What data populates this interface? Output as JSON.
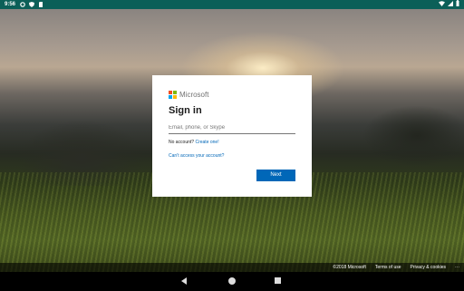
{
  "status_bar": {
    "time": "9:56",
    "icons": [
      "settings-icon",
      "shield-icon",
      "sd-card-icon"
    ],
    "right_icons": [
      "wifi-icon",
      "signal-icon",
      "battery-icon"
    ]
  },
  "signin": {
    "brand": "Microsoft",
    "title": "Sign in",
    "email_placeholder": "Email, phone, or Skype",
    "no_account_text": "No account?",
    "create_link": "Create one!",
    "cant_access": "Can’t access your account?",
    "next_label": "Next"
  },
  "footer": {
    "copyright": "©2018 Microsoft",
    "terms": "Terms of use",
    "privacy": "Privacy & cookies",
    "more": "···"
  },
  "colors": {
    "status_bar": "#0b5f58",
    "accent": "#0067b8",
    "ms_red": "#f25022",
    "ms_green": "#7fba00",
    "ms_blue": "#00a4ef",
    "ms_yellow": "#ffb900"
  }
}
